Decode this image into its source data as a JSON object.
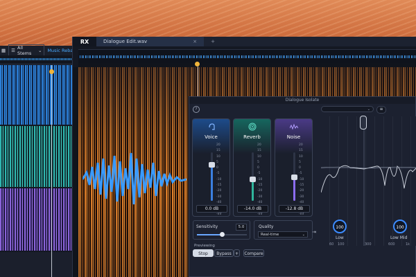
{
  "back_window": {
    "stem_selector": "All Stems",
    "link_text": "Music Rebala"
  },
  "main_window": {
    "logo": "RX",
    "tab_title": "Dialogue Edit.wav",
    "tab_close": "×",
    "new_tab": "+"
  },
  "panel": {
    "title": "Dialogue Isolate",
    "help": "?",
    "preset_caret": "⌄",
    "menu": "≡",
    "channels": [
      {
        "name": "Voice",
        "icon": "voice-icon",
        "value": "0.0 dB",
        "color": "#3b7fe0",
        "level": 0.75
      },
      {
        "name": "Reverb",
        "icon": "reverb-icon",
        "value": "-14.0 dB",
        "color": "#2fb59c",
        "level": 0.45
      },
      {
        "name": "Noise",
        "icon": "noise-icon",
        "value": "-12.8 dB",
        "color": "#8b6cf0",
        "level": 0.48
      }
    ],
    "scale": [
      "20",
      "15",
      "10",
      "5",
      "0",
      "-5",
      "-10",
      "-15",
      "-20",
      "-30",
      "-40",
      "-50",
      "-Inf"
    ],
    "sensitivity": {
      "label": "Sensitivity",
      "value": "5.0",
      "level": 0.5
    },
    "quality": {
      "label": "Quality",
      "selected": "Real-time",
      "caret": "⌄",
      "pin": "⇥"
    },
    "previewing": "Previewing",
    "buttons": {
      "stop": "Stop",
      "bypass": "Bypass",
      "plus": "+",
      "compare": "Compare"
    },
    "bands": [
      {
        "label": "Low",
        "value": "100"
      },
      {
        "label": "Low Mid",
        "value": "100"
      }
    ],
    "axis": [
      "60",
      "100",
      "300",
      "600",
      "1k"
    ]
  },
  "colors": {
    "accent": "#3d8cff",
    "voice": "#3b7fe0",
    "reverb": "#2fb59c",
    "noise": "#8b6cf0",
    "spectrogram": "#e0802a"
  }
}
